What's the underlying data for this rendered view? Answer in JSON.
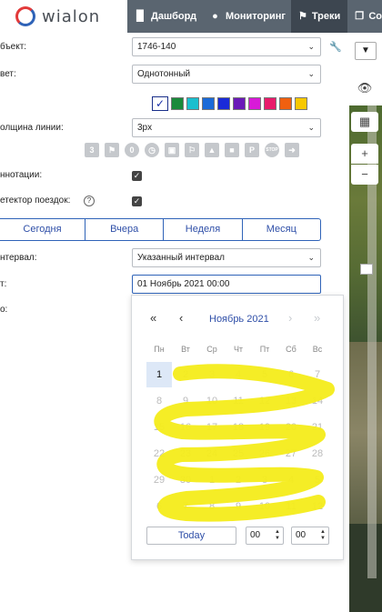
{
  "header": {
    "logo_text": "wialon",
    "nav": [
      {
        "label": "Дашборд",
        "icon": "bar-chart-icon"
      },
      {
        "label": "Мониторинг",
        "icon": "globe-icon"
      },
      {
        "label": "Треки",
        "icon": "checkered-flag-icon",
        "active": true
      },
      {
        "label": "Со",
        "icon": "copy-icon"
      }
    ]
  },
  "form": {
    "object_label": "бъект:",
    "object_value": "1746-140",
    "color_label": "вет:",
    "color_value": "Однотонный",
    "swatches": [
      "#ffffff",
      "#1a8a3a",
      "#1abfcf",
      "#1a6ad8",
      "#1a2ad8",
      "#6a1ab8",
      "#d81ad8",
      "#e81a6a",
      "#f06010",
      "#f8c800"
    ],
    "thickness_label": "олщина линии:",
    "thickness_value": "3px",
    "marker_icons": [
      "3",
      "flag",
      "0",
      "clock",
      "fuel",
      "flag",
      "img",
      "video",
      "P",
      "STOP",
      "arrow"
    ],
    "annotations_label": "ннотации:",
    "trip_detector_label": "етектор поездок:",
    "periods": [
      "Сегодня",
      "Вчера",
      "Неделя",
      "Месяц"
    ],
    "interval_label": "нтервал:",
    "interval_value": "Указанный интервал",
    "from_label": "т:",
    "from_value": "01 Ноябрь 2021 00:00",
    "to_label": "о:"
  },
  "calendar": {
    "month_label": "Ноябрь 2021",
    "dow": [
      "Пн",
      "Вт",
      "Ср",
      "Чт",
      "Пт",
      "Сб",
      "Вс"
    ],
    "weeks": [
      [
        "1",
        "2",
        "3",
        "4",
        "5",
        "6",
        "7"
      ],
      [
        "8",
        "9",
        "10",
        "11",
        "12",
        "13",
        "14"
      ],
      [
        "15",
        "16",
        "17",
        "18",
        "19",
        "20",
        "21"
      ],
      [
        "22",
        "23",
        "24",
        "25",
        "26",
        "27",
        "28"
      ],
      [
        "29",
        "30",
        "1",
        "2",
        "3",
        "4",
        "5"
      ],
      [
        "6",
        "7",
        "8",
        "9",
        "10",
        "11",
        "12"
      ]
    ],
    "today_label": "Today",
    "hours_value": "00",
    "minutes_value": "00"
  }
}
